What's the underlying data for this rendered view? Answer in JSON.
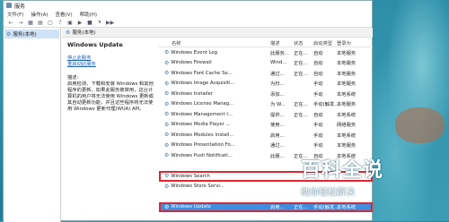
{
  "window": {
    "title": "服务"
  },
  "menu": [
    "文件(F)",
    "操作(A)",
    "查看(V)",
    "帮助(H)"
  ],
  "toolbar": [
    "←",
    "→",
    "▦",
    "▤",
    "▢",
    "?",
    "▣",
    "▶",
    "■",
    "⏸",
    "▶▶"
  ],
  "left_pane": {
    "item": "服务(本地)"
  },
  "main_header": "服务(本地)",
  "description": {
    "service_name": "Windows Update",
    "stop_link": "停止此服务",
    "restart_link": "重启动此服务",
    "heading": "描述:",
    "text": "启用检测、下载和安装 Windows 和其他程序的更新。如果此服务被禁用，这台计算机的用户将无法使用 Windows 更新或其自动更新功能，并且这些程序将无法使用 Windows 更新代理(WUA) API。"
  },
  "columns": [
    "名称",
    "描述",
    "状态",
    "启动类型",
    "登录为"
  ],
  "rows": [
    {
      "name": "Windows Event Log",
      "desc": "此服务...",
      "status": "正在...",
      "startup": "自动",
      "logon": "本地服务"
    },
    {
      "name": "Windows Firewall",
      "desc": "Wind...",
      "status": "正在...",
      "startup": "自动",
      "logon": "本地服务"
    },
    {
      "name": "Windows Font Cache Se...",
      "desc": "通过...",
      "status": "正在...",
      "startup": "自动",
      "logon": "本地服务"
    },
    {
      "name": "Windows Image Acquisiti...",
      "desc": "为扫...",
      "status": "",
      "startup": "手动",
      "logon": "本地服务"
    },
    {
      "name": "Windows Installer",
      "desc": "添加...",
      "status": "",
      "startup": "手动",
      "logon": "本地系统"
    },
    {
      "name": "Windows License Manag...",
      "desc": "为 W...",
      "status": "正在...",
      "startup": "手动(触发...",
      "logon": "本地服务"
    },
    {
      "name": "Windows Management I...",
      "desc": "提供...",
      "status": "正在...",
      "startup": "自动",
      "logon": "本地系统"
    },
    {
      "name": "Windows Media Player ...",
      "desc": "使用...",
      "status": "",
      "startup": "手动",
      "logon": "网络服务"
    },
    {
      "name": "Windows Modules Install...",
      "desc": "启用...",
      "status": "",
      "startup": "手动",
      "logon": "本地系统"
    },
    {
      "name": "Windows Presentation Fo...",
      "desc": "通过...",
      "status": "",
      "startup": "手动",
      "logon": "本地服务"
    },
    {
      "name": "Windows Push Notificati...",
      "desc": "此服...",
      "status": "正在...",
      "startup": "自动",
      "logon": "本地系统"
    },
    {
      "name": "",
      "desc": "",
      "status": "",
      "startup": "",
      "logon": ""
    },
    {
      "name": "Windows Search",
      "desc": "",
      "status": "",
      "startup": "",
      "logon": ""
    },
    {
      "name": "Windows Store Servi...",
      "desc": "",
      "status": "",
      "startup": "",
      "logon": ""
    },
    {
      "name": "",
      "desc": "",
      "status": "",
      "startup": "",
      "logon": ""
    },
    {
      "name": "Windows Update",
      "desc": "启用...",
      "status": "正在...",
      "startup": "手动(触发...",
      "logon": "本地系统"
    }
  ],
  "watermark": {
    "main": "百科全说",
    "sub": "助你轻松解决"
  }
}
